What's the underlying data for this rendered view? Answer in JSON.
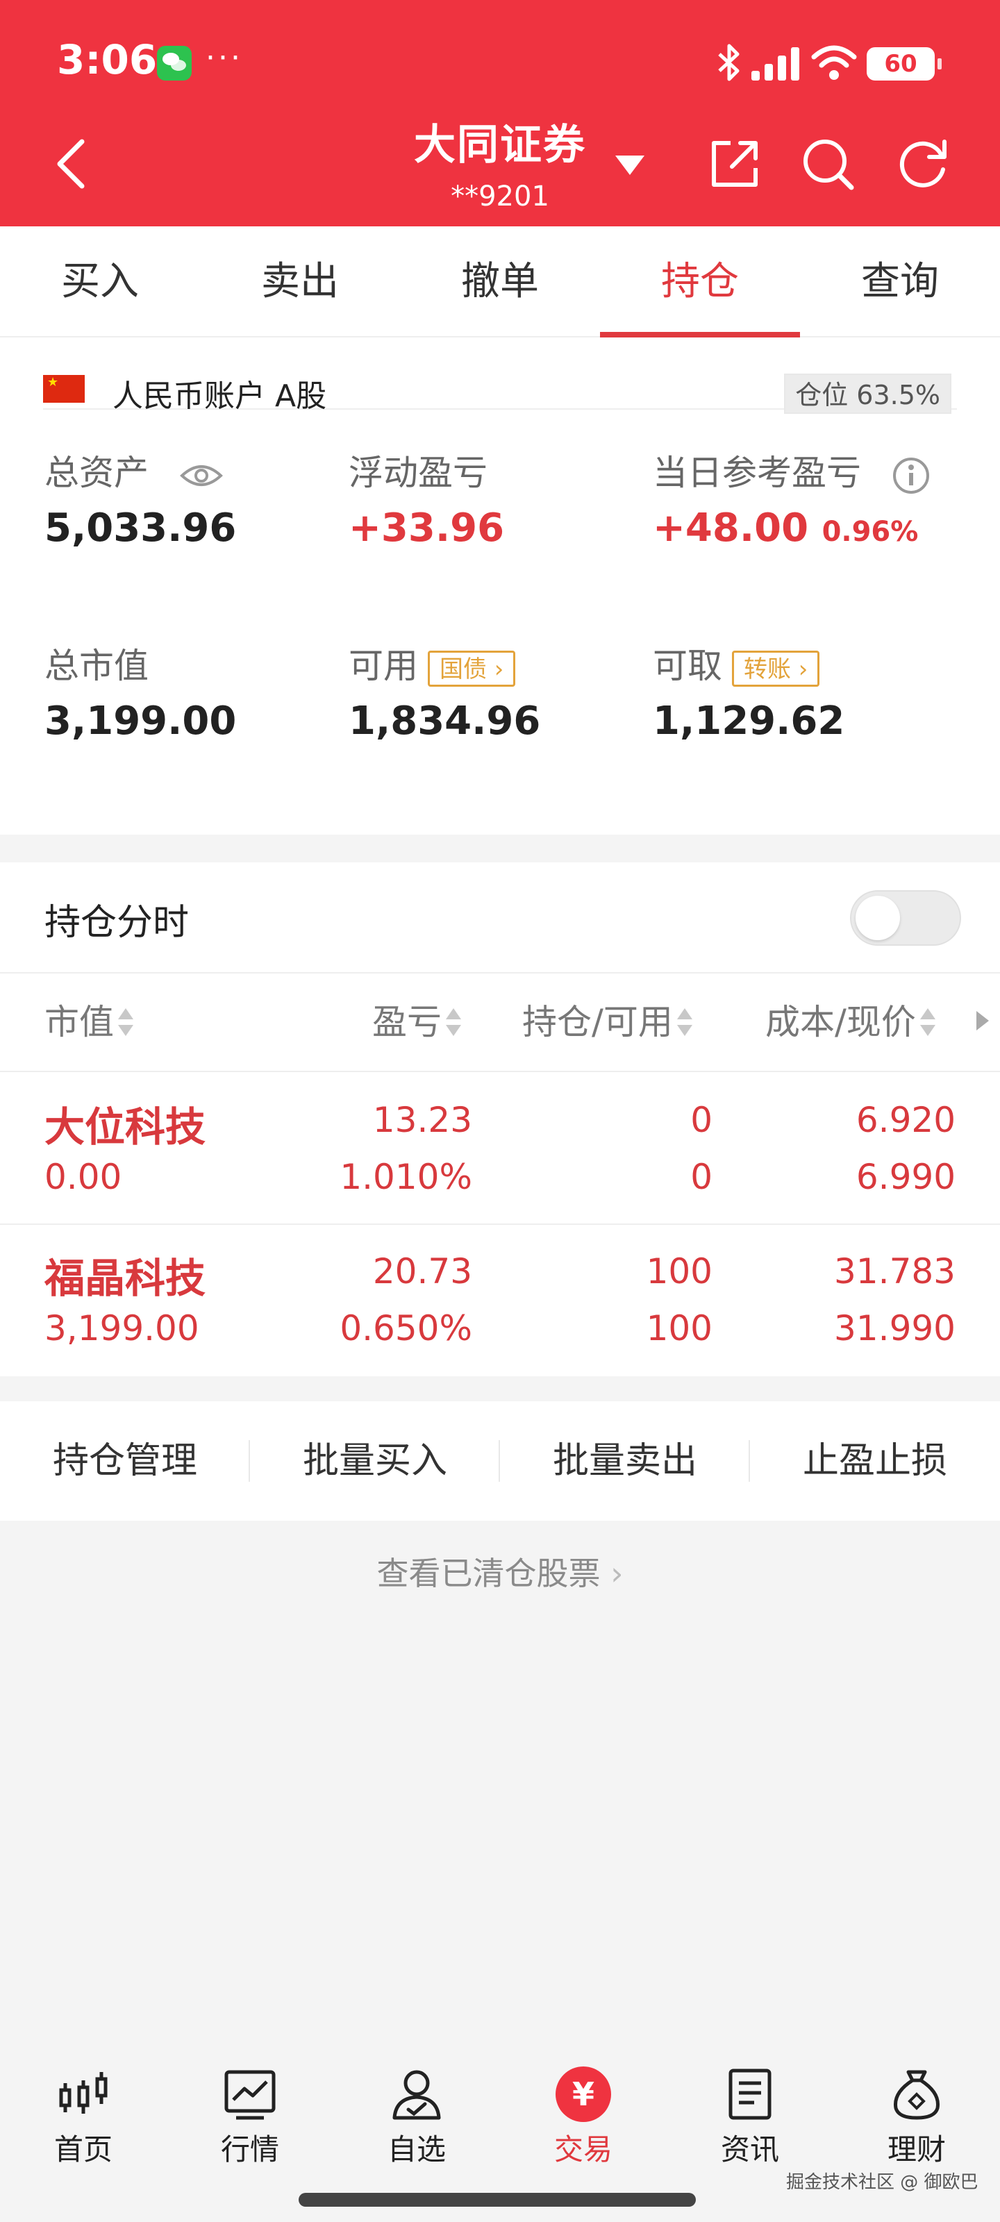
{
  "status_bar": {
    "time": "3:06",
    "dots": "···",
    "battery": "60"
  },
  "header": {
    "broker": "大同证券",
    "account": "**9201"
  },
  "tabs": [
    {
      "label": "买入"
    },
    {
      "label": "卖出"
    },
    {
      "label": "撤单"
    },
    {
      "label": "持仓"
    },
    {
      "label": "查询"
    }
  ],
  "active_tab": "持仓",
  "account_line": {
    "label": "人民币账户 A股",
    "position": "仓位 63.5%"
  },
  "metrics": {
    "total_assets": {
      "label": "总资产",
      "value": "5,033.96"
    },
    "floating_pl": {
      "label": "浮动盈亏",
      "value": "+33.96"
    },
    "daily_pl": {
      "label": "当日参考盈亏",
      "value": "+48.00",
      "pct": "0.96%"
    },
    "market_value": {
      "label": "总市值",
      "value": "3,199.00"
    },
    "available": {
      "label": "可用",
      "tag": "国债",
      "value": "1,834.96"
    },
    "withdrawable": {
      "label": "可取",
      "tag": "转账",
      "value": "1,129.62"
    }
  },
  "holdings": {
    "title": "持仓分时",
    "columns": [
      "市值",
      "盈亏",
      "持仓/可用",
      "成本/现价"
    ],
    "rows": [
      {
        "name": "大位科技",
        "market_value": "0.00",
        "pl": "13.23",
        "pl_pct": "1.010%",
        "position": "0",
        "available": "0",
        "cost": "6.920",
        "price": "6.990"
      },
      {
        "name": "福晶科技",
        "market_value": "3,199.00",
        "pl": "20.73",
        "pl_pct": "0.650%",
        "position": "100",
        "available": "100",
        "cost": "31.783",
        "price": "31.990"
      }
    ]
  },
  "actions": [
    {
      "label": "持仓管理"
    },
    {
      "label": "批量买入"
    },
    {
      "label": "批量卖出"
    },
    {
      "label": "止盈止损"
    }
  ],
  "cleared_link": "查看已清仓股票",
  "bottom_nav": [
    {
      "label": "首页",
      "icon": "candlestick-icon"
    },
    {
      "label": "行情",
      "icon": "chart-icon"
    },
    {
      "label": "自选",
      "icon": "person-check-icon"
    },
    {
      "label": "交易",
      "icon": "yuan-icon",
      "glyph": "¥"
    },
    {
      "label": "资讯",
      "icon": "document-icon"
    },
    {
      "label": "理财",
      "icon": "money-bag-icon"
    }
  ],
  "watermark": "掘金技术社区 @ 御欧巴",
  "colors": {
    "brand_red": "#ef3340",
    "gain_red": "#e0393e",
    "tag_orange": "#e3a33b"
  }
}
